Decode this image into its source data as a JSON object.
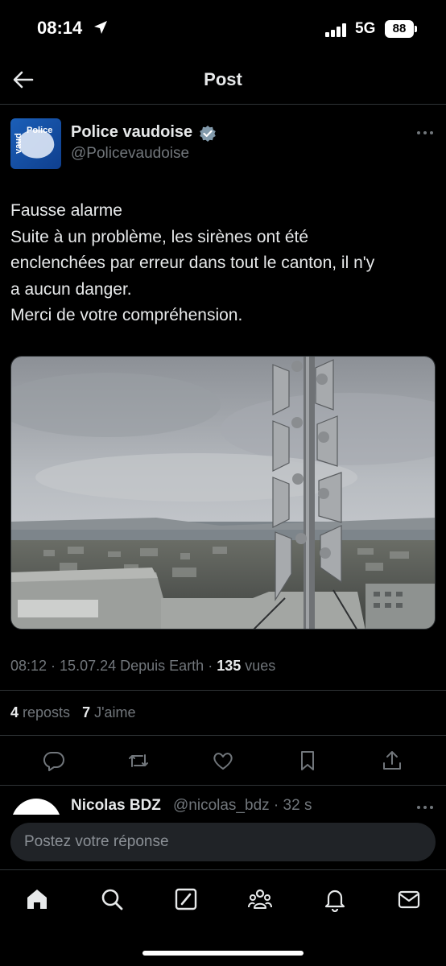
{
  "status_bar": {
    "time": "08:14",
    "network": "5G",
    "battery": "88"
  },
  "header": {
    "title": "Post",
    "back_icon": "arrow-left-icon"
  },
  "post": {
    "author": {
      "name": "Police vaudoise",
      "handle": "@Policevaudoise",
      "verified": true,
      "avatar_logo_text": "Police vaud"
    },
    "text_lines": [
      "Fausse alarme",
      "Suite à un problème, les sirènes ont été",
      "enclenchées par erreur dans tout le canton, il n'y",
      "a aucun danger.",
      "Merci de votre compréhension."
    ],
    "image_icon": "siren-tower-photo",
    "meta": {
      "time": "08:12",
      "date": "15.07.24",
      "source": "Depuis Earth",
      "views_count": "135",
      "views_label": "vues"
    },
    "stats": {
      "reposts_count": "4",
      "reposts_label": "reposts",
      "likes_count": "7",
      "likes_label": "J'aime"
    },
    "actions": [
      "reply-icon",
      "repost-icon",
      "like-icon",
      "bookmark-icon",
      "share-icon"
    ]
  },
  "reply_preview": {
    "name": "Nicolas BDZ",
    "handle": "@nicolas_bdz",
    "age": "32 s"
  },
  "reply_box": {
    "placeholder": "Postez votre réponse"
  },
  "tab_bar": [
    "home-icon",
    "search-icon",
    "grok-icon",
    "communities-icon",
    "notifications-icon",
    "messages-icon"
  ],
  "colors": {
    "background": "#000000",
    "text": "#e7e9ea",
    "muted": "#71767b",
    "accent": "#1d9bf0"
  }
}
